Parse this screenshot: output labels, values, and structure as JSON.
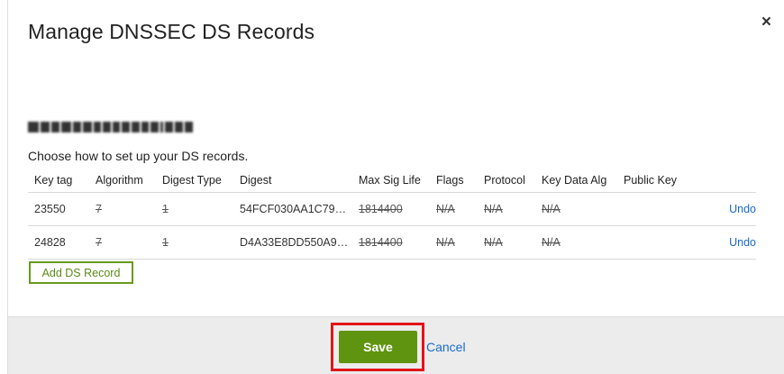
{
  "dialog": {
    "title": "Manage DNSSEC DS Records",
    "close_label": "×",
    "domain_redacted": "MYDOMAINXXXXX.ORG",
    "instructions": "Choose how to set up your DS records."
  },
  "table": {
    "headers": [
      "Key tag",
      "Algorithm",
      "Digest Type",
      "Digest",
      "Max Sig Life",
      "Flags",
      "Protocol",
      "Key Data Alg",
      "Public Key",
      ""
    ],
    "rows": [
      {
        "key_tag": "23550",
        "algorithm": "7",
        "digest_type": "1",
        "digest": "54FCF030AA1C79…",
        "max_sig_life": "1814400",
        "flags": "N/A",
        "protocol": "N/A",
        "key_data_alg": "N/A",
        "public_key": "",
        "action": "Undo"
      },
      {
        "key_tag": "24828",
        "algorithm": "7",
        "digest_type": "1",
        "digest": "D4A33E8DD550A9…",
        "max_sig_life": "1814400",
        "flags": "N/A",
        "protocol": "N/A",
        "key_data_alg": "N/A",
        "public_key": "",
        "action": "Undo"
      }
    ]
  },
  "add_button_label": "Add DS Record",
  "footer": {
    "save_label": "Save",
    "cancel_label": "Cancel"
  },
  "colors": {
    "primary_green": "#5f9410",
    "link_blue": "#1a6ac9",
    "highlight_red": "#e3141a"
  }
}
